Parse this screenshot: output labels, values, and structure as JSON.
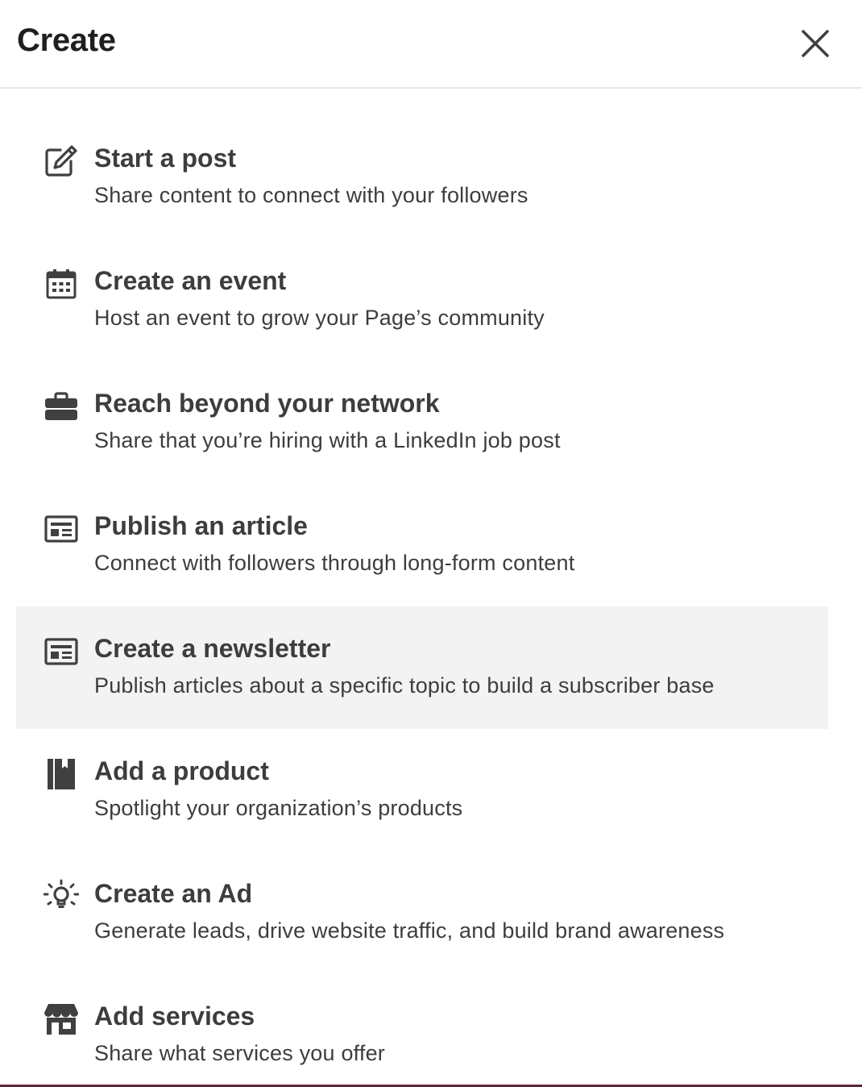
{
  "dialog": {
    "title": "Create",
    "close_icon": "close-icon"
  },
  "items": [
    {
      "label": "Start a post",
      "description": "Share content to connect with your followers",
      "icon": "pencil-square-icon"
    },
    {
      "label": "Create an event",
      "description": "Host an event to grow your Page’s community",
      "icon": "calendar-icon"
    },
    {
      "label": "Reach beyond your network",
      "description": "Share that you’re hiring with a LinkedIn job post",
      "icon": "briefcase-icon"
    },
    {
      "label": "Publish an article",
      "description": "Connect with followers through long-form content",
      "icon": "article-icon"
    },
    {
      "label": "Create a newsletter",
      "description": "Publish articles about a specific topic to build a subscriber base",
      "icon": "newsletter-icon"
    },
    {
      "label": "Add a product",
      "description": "Spotlight your organization’s products",
      "icon": "book-icon"
    },
    {
      "label": "Create an Ad",
      "description": "Generate leads, drive website traffic, and build brand awareness",
      "icon": "lightbulb-icon"
    },
    {
      "label": "Add services",
      "description": "Share what services you offer",
      "icon": "storefront-icon"
    }
  ],
  "colors": {
    "text": "#3d3d3d",
    "title": "#1f1f1f",
    "highlight": "#f3f3f3",
    "icon": "#404040"
  }
}
